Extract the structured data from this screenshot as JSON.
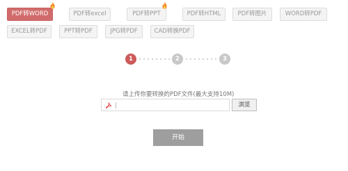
{
  "tabs": [
    {
      "label": "PDF转WORD",
      "active": true,
      "hot": true
    },
    {
      "label": "PDF转excel",
      "active": false,
      "hot": false
    },
    {
      "label": "PDF转PPT",
      "active": false,
      "hot": true
    },
    {
      "label": "PDF转HTML",
      "active": false,
      "hot": false
    },
    {
      "label": "PDF转图片",
      "active": false,
      "hot": false
    },
    {
      "label": "WORD转PDF",
      "active": false,
      "hot": false
    },
    {
      "label": "EXCEL转PDF",
      "active": false,
      "hot": false
    },
    {
      "label": "PPT转PDF",
      "active": false,
      "hot": false
    },
    {
      "label": "JPG转PDF",
      "active": false,
      "hot": false
    },
    {
      "label": "CAD转换PDF",
      "active": false,
      "hot": false
    }
  ],
  "steps": [
    {
      "number": "1",
      "active": true
    },
    {
      "number": "2",
      "active": false
    },
    {
      "number": "3",
      "active": false
    }
  ],
  "upload": {
    "hint": "请上传你要转换的PDF文件(最大支持10M)",
    "file_value": "",
    "browse_label": "浏览"
  },
  "start_label": "开始",
  "colors": {
    "accent": "#d16b6b",
    "step_active": "#cd5a5a",
    "step_inactive": "#c8c8c8",
    "start_button": "#9e9e9e"
  },
  "icons": {
    "hot": "fire-icon",
    "file": "pdf-file-icon"
  }
}
